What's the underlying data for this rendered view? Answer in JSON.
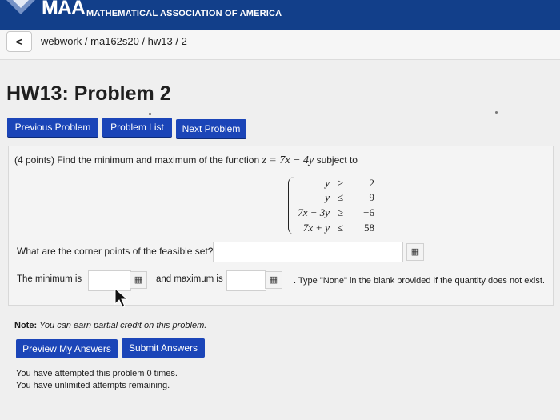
{
  "header": {
    "logo_text": "MAA",
    "org_name": "MATHEMATICAL ASSOCIATION OF AMERICA"
  },
  "nav": {
    "back_symbol": "<",
    "breadcrumb": "webwork / ma162s20 / hw13 / 2"
  },
  "page": {
    "title": "HW13: Problem 2"
  },
  "problem_nav": {
    "previous": "Previous Problem",
    "list": "Problem List",
    "next": "Next Problem"
  },
  "problem": {
    "statement_prefix": "(4 points) Find the minimum and maximum of the function ",
    "function": "z = 7x − 4y",
    "statement_suffix": " subject to",
    "constraints": [
      {
        "lhs": "y",
        "op": "≥",
        "rhs": "2"
      },
      {
        "lhs": "y",
        "op": "≤",
        "rhs": "9"
      },
      {
        "lhs": "7x − 3y",
        "op": "≥",
        "rhs": "−6"
      },
      {
        "lhs": "7x + y",
        "op": "≤",
        "rhs": "58"
      }
    ],
    "corner_question": "What are the corner points of the feasible set?",
    "corner_value": "",
    "min_label": "The minimum is",
    "min_value": "",
    "max_label": "and maximum is",
    "max_value": "",
    "hint": ". Type \"None\" in the blank provided if the quantity does not exist."
  },
  "note": {
    "label": "Note:",
    "text": "You can earn partial credit on this problem."
  },
  "actions": {
    "preview": "Preview My Answers",
    "submit": "Submit Answers"
  },
  "attempts": {
    "line1": "You have attempted this problem 0 times.",
    "line2": "You have unlimited attempts remaining."
  },
  "colors": {
    "header_bg": "#123f8a",
    "button_bg": "#1b45b8"
  },
  "icons": {
    "grid": "equation-editor-icon",
    "back": "chevron-left-icon",
    "logo": "maa-logo-icon"
  }
}
